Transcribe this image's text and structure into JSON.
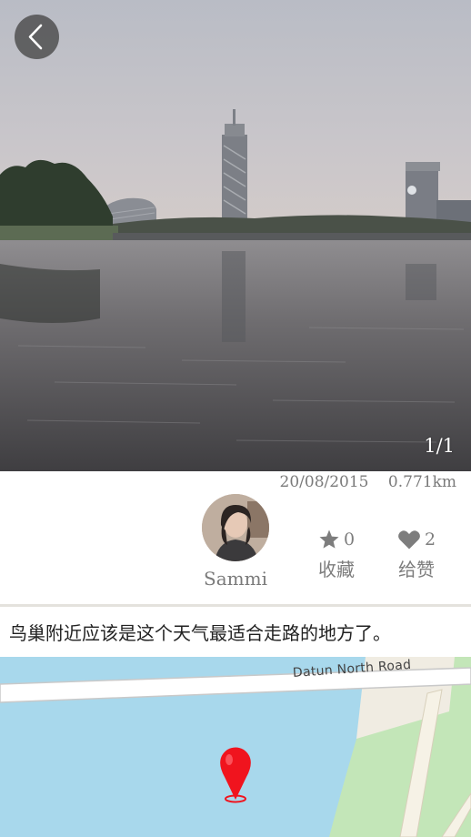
{
  "photo": {
    "counter": "1/1"
  },
  "post": {
    "date": "20/08/2015",
    "distance": "0.771km",
    "author": "Sammi",
    "text": "鸟巢附近应该是这个天气最适合走路的地方了。"
  },
  "stats": {
    "favorite": {
      "count": "0",
      "label": "收藏"
    },
    "like": {
      "count": "2",
      "label": "给赞"
    }
  },
  "map": {
    "road_name": "Datun North Road",
    "pin_color": "#f0141e"
  },
  "icons": {
    "back": "chevron-left-icon",
    "favorite": "star-icon",
    "like": "heart-icon",
    "pin": "map-pin-icon"
  }
}
